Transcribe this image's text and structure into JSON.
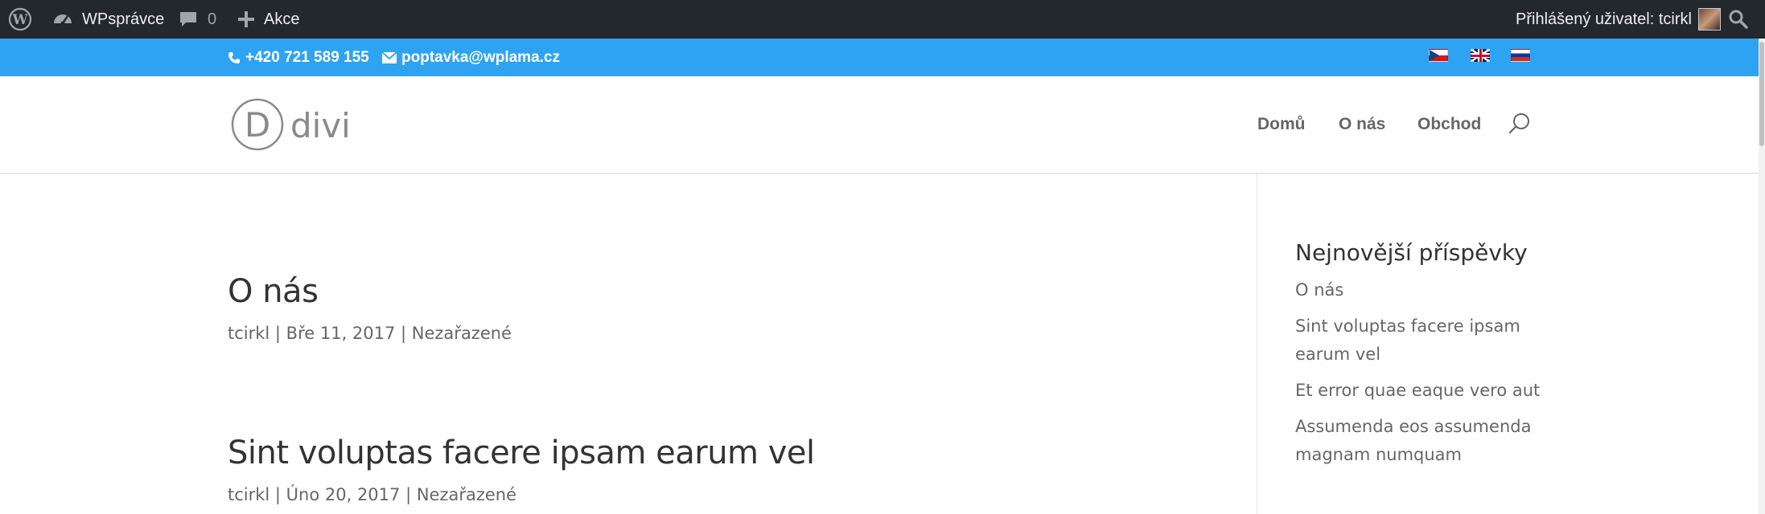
{
  "admin_bar": {
    "site_name": "WPsprávce",
    "comments_count": "0",
    "new_label": "Akce",
    "user_greeting": "Přihlášený uživatel: tcirkl",
    "icons": [
      "wordpress-logo-icon",
      "dashboard-icon",
      "comment-icon",
      "plus-icon",
      "search-icon"
    ]
  },
  "top_bar": {
    "phone": "+420 721 589 155",
    "email": "poptavka@wplama.cz",
    "languages": [
      "cs",
      "en",
      "ru"
    ],
    "color": "#2ea3f2"
  },
  "header": {
    "logo_text": "divi",
    "logo_letter": "D",
    "nav": [
      "Domů",
      "O nás",
      "Obchod"
    ]
  },
  "posts": [
    {
      "title": "O nás",
      "meta": "tcirkl | Bře 11, 2017 | Nezařazené"
    },
    {
      "title": "Sint voluptas facere ipsam earum vel",
      "meta": "tcirkl | Úno 20, 2017 | Nezařazené"
    }
  ],
  "sidebar": {
    "title": "Nejnovější příspěvky",
    "items": [
      "O nás",
      "Sint voluptas facere ipsam earum vel",
      "Et error quae eaque vero aut",
      "Assumenda eos assumenda magnam numquam"
    ]
  },
  "colors": {
    "admin_bar": "#23282d",
    "accent": "#2ea3f2",
    "text": "#666666",
    "heading": "#333333"
  }
}
